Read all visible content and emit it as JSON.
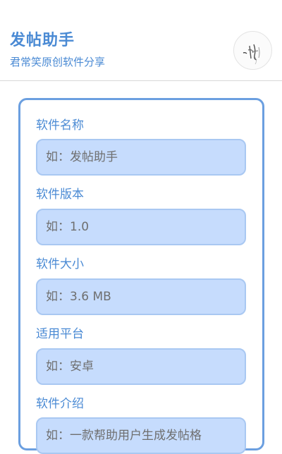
{
  "header": {
    "title": "发帖助手",
    "subtitle": "君常笑原创软件分享",
    "avatar_icon": "handwriting-logo"
  },
  "form": {
    "fields": [
      {
        "label": "软件名称",
        "placeholder": "如：发帖助手",
        "value": ""
      },
      {
        "label": "软件版本",
        "placeholder": "如：1.0",
        "value": ""
      },
      {
        "label": "软件大小",
        "placeholder": "如：3.6 MB",
        "value": ""
      },
      {
        "label": "适用平台",
        "placeholder": "如：安卓",
        "value": ""
      },
      {
        "label": "软件介绍",
        "placeholder": "如：一款帮助用户生成发帖格",
        "value": ""
      }
    ]
  },
  "colors": {
    "accent": "#4a8ad4",
    "card_border": "#6b9fe0",
    "input_bg": "#c6dcfd",
    "input_border": "#a9c8f2"
  }
}
